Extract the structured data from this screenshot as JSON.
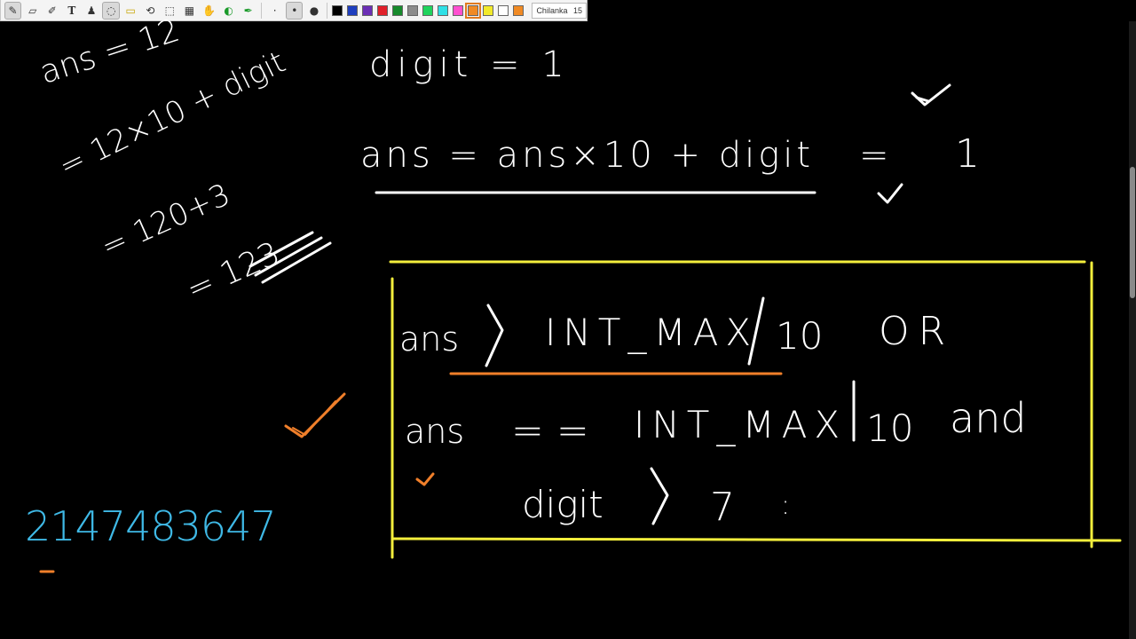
{
  "toolbar": {
    "tools": [
      {
        "name": "pen-icon",
        "glyph": "✎"
      },
      {
        "name": "eraser-icon",
        "glyph": "▱"
      },
      {
        "name": "highlighter-icon",
        "glyph": "✐"
      },
      {
        "name": "text-icon",
        "glyph": "T"
      },
      {
        "name": "stamp-icon",
        "glyph": "♟"
      },
      {
        "name": "lasso-icon",
        "glyph": "◌"
      },
      {
        "name": "ruler-icon",
        "glyph": "▭"
      },
      {
        "name": "shapes-icon",
        "glyph": "⟲"
      },
      {
        "name": "select-rect-icon",
        "glyph": "⬚"
      },
      {
        "name": "select-all-icon",
        "glyph": "▦"
      },
      {
        "name": "hand-icon",
        "glyph": "✋"
      },
      {
        "name": "color-picker-icon",
        "glyph": "◐"
      },
      {
        "name": "custom-pen-icon",
        "glyph": "✒"
      }
    ],
    "sizes": [
      "·",
      "•",
      "●"
    ],
    "colors": [
      "#000000",
      "#1f3fbf",
      "#6b2fb5",
      "#e0202a",
      "#178a2c",
      "#8c8c8c",
      "#1fd35c",
      "#2fe0e6",
      "#ff4fd0",
      "#f08a24",
      "#f2ea2a",
      "#ffffff",
      "#f08a24"
    ],
    "active_color_index": 9,
    "font_name": "Chilanka",
    "font_size": "15"
  },
  "notes": {
    "ans_eq_12": "ans = 12",
    "eq_12x10_digit": "= 12×10 + digit",
    "eq_120_3": "= 120+3",
    "eq_123": "= 123",
    "digit_eq_1": "digit = 1",
    "formula": "ans = ans×10 + digit",
    "formula_eq": "=",
    "formula_result": "1",
    "cond_line1_ans": "ans",
    "cond_line1_op": ">",
    "cond_line1_const": "INT_MAX",
    "cond_line1_div": "10",
    "cond_line1_or": "OR",
    "cond_line2_ans": "ans",
    "cond_line2_op": "==",
    "cond_line2_const": "INT_MAX",
    "cond_line2_div": "10",
    "cond_line2_and": "and",
    "cond_line3_digit": "digit",
    "cond_line3_op": ">",
    "cond_line3_val": "7",
    "cond_line3_tail": ":",
    "int_max_value": "2147483647",
    "colors": {
      "white": "#ffffff",
      "yellow": "#f3ee3c",
      "orange": "#f07f2a",
      "blue": "#3fb9e6"
    }
  }
}
